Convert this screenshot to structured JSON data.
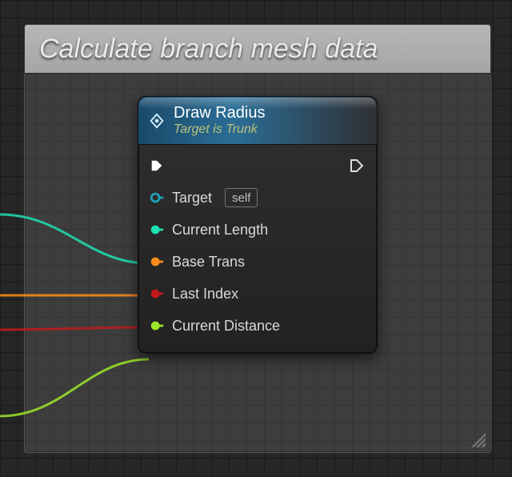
{
  "comment": {
    "title": "Calculate branch mesh data"
  },
  "node": {
    "title": "Draw Radius",
    "subtitle": "Target is Trunk",
    "pins": [
      {
        "key": "exec_in",
        "label": "",
        "color": "#ffffff",
        "connected": true,
        "kind": "exec"
      },
      {
        "key": "target",
        "label": "Target",
        "color": "#1fa2bd",
        "connected": false,
        "kind": "object",
        "default": "self"
      },
      {
        "key": "curlen",
        "label": "Current Length",
        "color": "#1fe0b3",
        "connected": true,
        "kind": "float"
      },
      {
        "key": "basetrans",
        "label": "Base Trans",
        "color": "#ff8c1a",
        "connected": true,
        "kind": "struct"
      },
      {
        "key": "lastidx",
        "label": "Last Index",
        "color": "#c21a1a",
        "connected": true,
        "kind": "int"
      },
      {
        "key": "curdist",
        "label": "Current Distance",
        "color": "#9de62a",
        "connected": true,
        "kind": "float"
      }
    ],
    "exec_out_connected": false
  },
  "colors": {
    "wire_teal": "#1fe0b3",
    "wire_orange": "#ff8c1a",
    "wire_red": "#c21a1a",
    "wire_lime": "#9de62a"
  }
}
